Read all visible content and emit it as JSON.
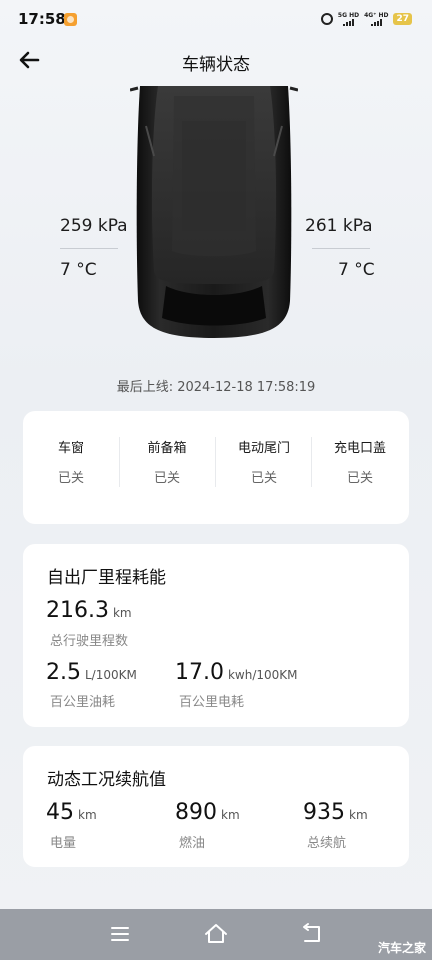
{
  "status_bar": {
    "time": "17:58",
    "network1": "5G HD",
    "network2": "4G⁺ HD",
    "battery": "27"
  },
  "header": {
    "title": "车辆状态"
  },
  "tires": {
    "front_left_pressure": "259 kPa",
    "front_right_pressure": "261 kPa",
    "left_temp": "7 °C",
    "right_temp": "7 °C"
  },
  "last_online": "最后上线:   2024-12-18 17:58:19",
  "vehicle_status": [
    {
      "label": "车窗",
      "value": "已关"
    },
    {
      "label": "前备箱",
      "value": "已关"
    },
    {
      "label": "电动尾门",
      "value": "已关"
    },
    {
      "label": "充电口盖",
      "value": "已关"
    }
  ],
  "mileage": {
    "title": "自出厂里程耗能",
    "total_value": "216.3",
    "total_unit": "km",
    "total_label": "总行驶里程数",
    "fuel_value": "2.5",
    "fuel_unit": "L/100KM",
    "fuel_label": "百公里油耗",
    "elec_value": "17.0",
    "elec_unit": "kwh/100KM",
    "elec_label": "百公里电耗"
  },
  "range": {
    "title": "动态工况续航值",
    "battery_value": "45",
    "battery_unit": "km",
    "battery_label": "电量",
    "fuel_value": "890",
    "fuel_unit": "km",
    "fuel_label": "燃油",
    "total_value": "935",
    "total_unit": "km",
    "total_label": "总续航"
  },
  "watermark": "汽车之家"
}
